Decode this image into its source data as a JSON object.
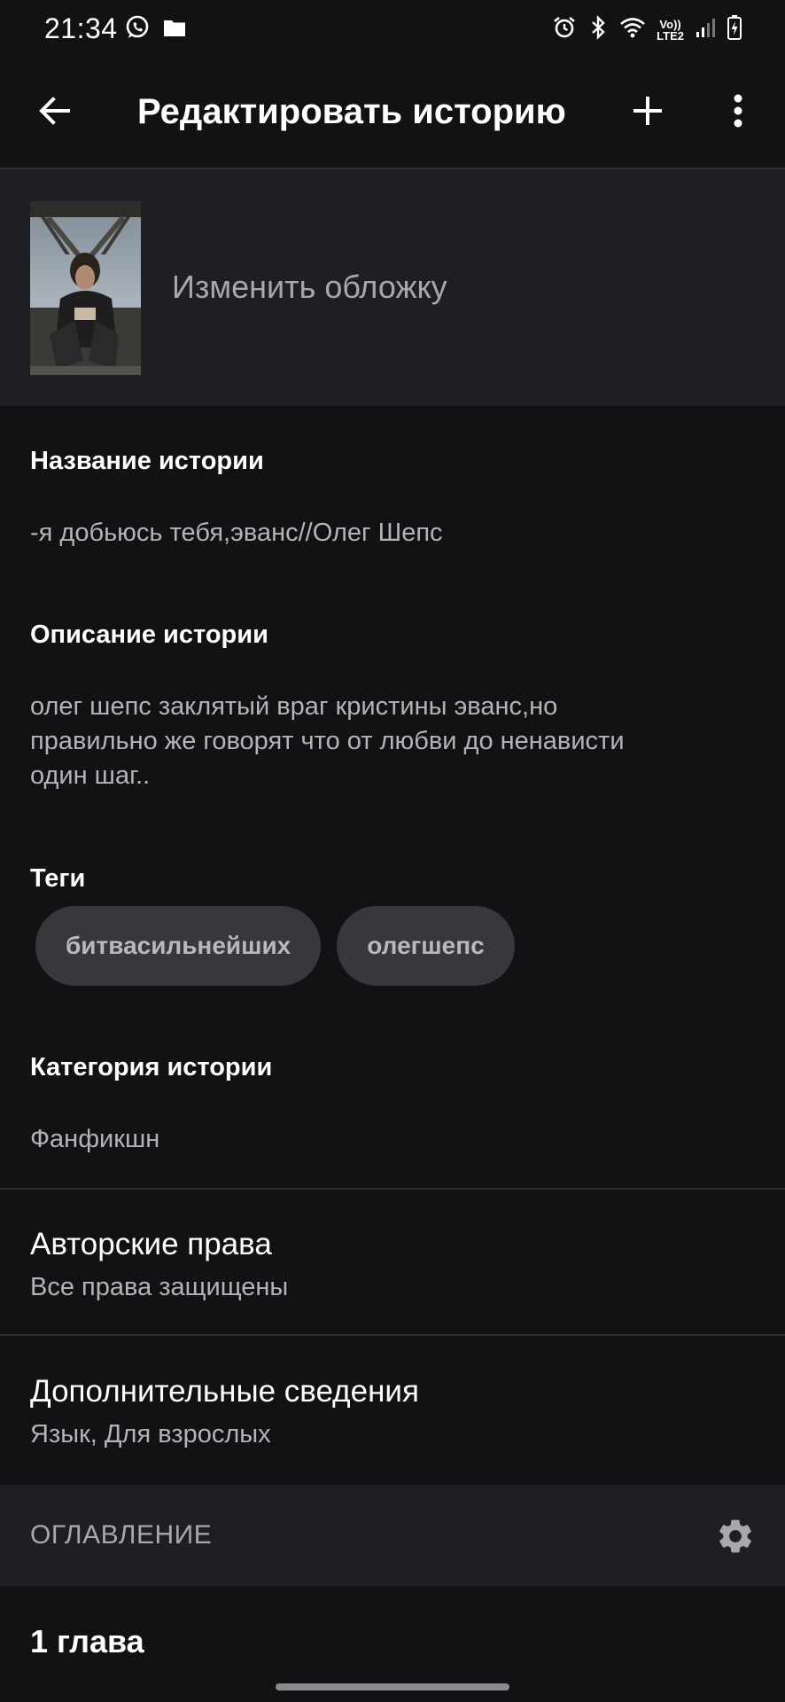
{
  "status_bar": {
    "time": "21:34",
    "left_icons": [
      "whatsapp-icon",
      "folder-icon"
    ],
    "right_icons": [
      "alarm-icon",
      "bluetooth-icon",
      "wifi-icon",
      "volte-icon",
      "signal-icon",
      "battery-icon"
    ],
    "network_top": "Vo))",
    "network_bottom": "LTE2"
  },
  "app_bar": {
    "title": "Редактировать историю",
    "back_icon": "arrow-left-icon",
    "add_icon": "plus-icon",
    "more_icon": "more-vertical-icon"
  },
  "cover": {
    "label": "Изменить обложку"
  },
  "story": {
    "title_label": "Название истории",
    "title_value": "-я добьюсь тебя,эванс//Олег Шепс",
    "description_label": "Описание истории",
    "description_lines": [
      "олег шепс заклятый враг кристины эванс,но",
      "правильно же говорят что от любви до ненависти",
      "один шаг.."
    ],
    "tags_label": "Теги",
    "tags": [
      "битвасильнейших",
      "олегшепс"
    ],
    "category_label": "Категория истории",
    "category_value": "Фанфикшн"
  },
  "copyright": {
    "title": "Авторские права",
    "value": "Все права защищены"
  },
  "extra": {
    "title": "Дополнительные сведения",
    "value": "Язык, Для взрослых"
  },
  "toc": {
    "label": "ОГЛАВЛЕНИЕ",
    "settings_icon": "gear-icon",
    "chapters": [
      "1 глава"
    ]
  },
  "colors": {
    "background": "#121114",
    "surface": "#1f1e22",
    "chip": "#38373b",
    "text_primary": "#ffffff",
    "text_secondary": "#b4b3b7"
  }
}
